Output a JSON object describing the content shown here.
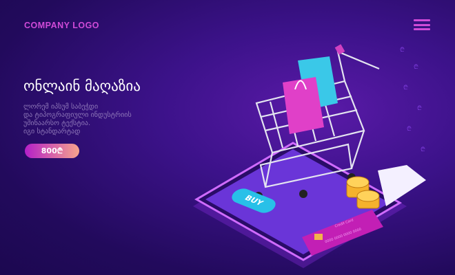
{
  "header": {
    "logo": "COMPANY LOGO",
    "menu_icon": "hamburger-icon"
  },
  "hero": {
    "title": "ონლაინ მაღაზია",
    "description": [
      "ლორემ იპსუმ საბეჭდი",
      "და ტიპოგრაფიული ინდუსტრიის",
      "უშინაარსო ტექსტია.",
      "იგი სტანდარტად"
    ],
    "price": "800₾"
  },
  "illustration": {
    "buy_label": "BUY",
    "card_name": "Credit Card",
    "card_number": "0000 0000 0000 0000"
  },
  "colors": {
    "accent": "#d04bd8",
    "buy": "#28c0e8",
    "card": "#c21fb5"
  }
}
